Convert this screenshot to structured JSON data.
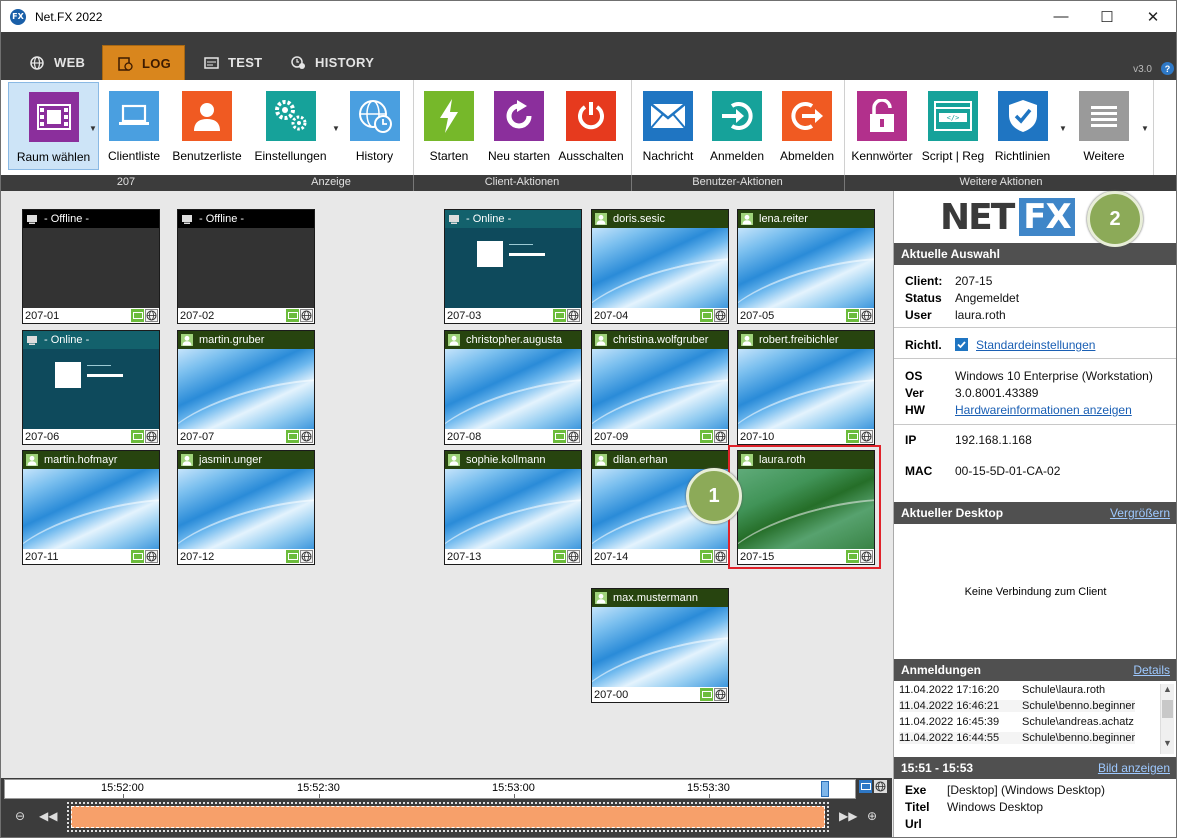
{
  "window": {
    "title": "Net.FX 2022",
    "minimize": "—",
    "maximize": "☐",
    "close": "✕"
  },
  "tabs": [
    {
      "label": "WEB",
      "icon": "globe-icon",
      "active": false
    },
    {
      "label": "LOG",
      "icon": "log-icon",
      "active": true
    },
    {
      "label": "TEST",
      "icon": "test-icon",
      "active": false
    },
    {
      "label": "HISTORY",
      "icon": "history-icon",
      "active": false
    }
  ],
  "version": "v3.0",
  "help": "?",
  "ribbon": {
    "buttons": [
      {
        "label": "Raum wählen",
        "icon": "film-icon",
        "color": "#8b2f9c"
      },
      {
        "label": "Clientliste",
        "icon": "laptop-icon",
        "color": "#4a9fe0"
      },
      {
        "label": "Benutzerliste",
        "icon": "user-icon",
        "color": "#f05a22"
      },
      {
        "label": "Einstellungen",
        "icon": "gears-icon",
        "color": "#16a29a"
      },
      {
        "label": "History",
        "icon": "history-clock-icon",
        "color": "#4a9fe0"
      },
      {
        "label": "Starten",
        "icon": "bolt-icon",
        "color": "#76b82a"
      },
      {
        "label": "Neu starten",
        "icon": "restart-icon",
        "color": "#8b2f9c"
      },
      {
        "label": "Ausschalten",
        "icon": "power-icon",
        "color": "#e63a1e"
      },
      {
        "label": "Nachricht",
        "icon": "mail-icon",
        "color": "#1f75c2"
      },
      {
        "label": "Anmelden",
        "icon": "login-icon",
        "color": "#16a29a"
      },
      {
        "label": "Abmelden",
        "icon": "logout-icon",
        "color": "#f05a22"
      },
      {
        "label": "Kennwörter",
        "icon": "lock-icon",
        "color": "#b2308c"
      },
      {
        "label": "Script | Reg",
        "icon": "code-icon",
        "color": "#16a29a"
      },
      {
        "label": "Richtlinien",
        "icon": "shield-check-icon",
        "color": "#1f75c2"
      },
      {
        "label": "Weitere",
        "icon": "list-icon",
        "color": "#9a9a9a"
      }
    ],
    "groups": [
      "207",
      "Anzeige",
      "Client-Aktionen",
      "Benutzer-Aktionen",
      "Weitere Aktionen"
    ]
  },
  "tiles": [
    {
      "id": "207-01",
      "head": "- Offline -",
      "state": "offline"
    },
    {
      "id": "207-02",
      "head": "- Offline -",
      "state": "offline"
    },
    {
      "id": "207-03",
      "head": "- Online -",
      "state": "online"
    },
    {
      "id": "207-04",
      "head": "doris.sesic",
      "state": "user"
    },
    {
      "id": "207-05",
      "head": "lena.reiter",
      "state": "user"
    },
    {
      "id": "207-06",
      "head": "- Online -",
      "state": "online"
    },
    {
      "id": "207-07",
      "head": "martin.gruber",
      "state": "user"
    },
    {
      "id": "207-08",
      "head": "christopher.augusta",
      "state": "user"
    },
    {
      "id": "207-09",
      "head": "christina.wolfgruber",
      "state": "user"
    },
    {
      "id": "207-10",
      "head": "robert.freibichler",
      "state": "user"
    },
    {
      "id": "207-11",
      "head": "martin.hofmayr",
      "state": "user"
    },
    {
      "id": "207-12",
      "head": "jasmin.unger",
      "state": "user"
    },
    {
      "id": "207-13",
      "head": "sophie.kollmann",
      "state": "user"
    },
    {
      "id": "207-14",
      "head": "dilan.erhan",
      "state": "user"
    },
    {
      "id": "207-15",
      "head": "laura.roth",
      "state": "selected"
    },
    {
      "id": "207-00",
      "head": "max.mustermann",
      "state": "user"
    }
  ],
  "callouts": [
    "1",
    "2"
  ],
  "panel": {
    "logo_net": "NET",
    "logo_fx": "FX",
    "selection_title": "Aktuelle Auswahl",
    "client_label": "Client:",
    "client": "207-15",
    "status_label": "Status",
    "status": "Angemeldet",
    "user_label": "User",
    "user": "laura.roth",
    "richtl_label": "Richtl.",
    "richtl": "Standardeinstellungen",
    "os_label": "OS",
    "os": "Windows 10 Enterprise (Workstation)",
    "ver_label": "Ver",
    "ver": "3.0.8001.43389",
    "hw_label": "HW",
    "hw": "Hardwareinformationen anzeigen",
    "ip_label": "IP",
    "ip": "192.168.1.168",
    "mac_label": "MAC",
    "mac": "00-15-5D-01-CA-02",
    "desktop_title": "Aktueller Desktop",
    "desktop_link": "Vergrößern",
    "desktop_msg": "Keine Verbindung zum Client",
    "logins_title": "Anmeldungen",
    "logins_link": "Details",
    "logins": [
      {
        "date": "11.04.2022 17:16:20",
        "user": "Schule\\laura.roth"
      },
      {
        "date": "11.04.2022 16:46:21",
        "user": "Schule\\benno.beginner"
      },
      {
        "date": "11.04.2022 16:45:39",
        "user": "Schule\\andreas.achatz"
      },
      {
        "date": "11.04.2022 16:44:55",
        "user": "Schule\\benno.beginner"
      }
    ],
    "range_title": "15:51 - 15:53",
    "range_link": "Bild anzeigen",
    "exe_label": "Exe",
    "exe": "[Desktop] (Windows Desktop)",
    "titel_label": "Titel",
    "titel": "Windows Desktop",
    "url_label": "Url",
    "url": ""
  },
  "timeline": {
    "ticks": [
      "15:52:00",
      "15:52:30",
      "15:53:00",
      "15:53:30"
    ]
  }
}
